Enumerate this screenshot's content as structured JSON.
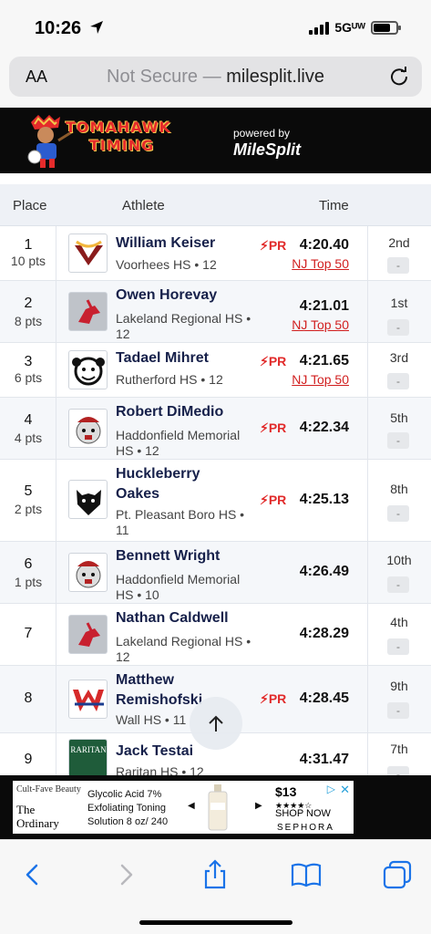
{
  "status": {
    "time": "10:26",
    "network": "5Gᵁᵂ"
  },
  "browser": {
    "aa": "AA",
    "security": "Not Secure",
    "separator": " — ",
    "domain": "milesplit.live"
  },
  "banner": {
    "brand_line1": "TOMAHAWK",
    "brand_line2": "TIMING",
    "powered_by": "powered by",
    "partner": "MileSplit"
  },
  "table": {
    "headers": {
      "place": "Place",
      "athlete": "Athlete",
      "time": "Time"
    },
    "rows": [
      {
        "place": "1",
        "pts": "10 pts",
        "name": "William Keiser",
        "school": "Voorhees HS • 12",
        "pr": "PR",
        "time": "4:20.40",
        "top50": "NJ Top 50",
        "rank": "2nd",
        "dash": "-"
      },
      {
        "place": "2",
        "pts": "8 pts",
        "name": "Owen Horevay",
        "school": "Lakeland Regional HS • 12",
        "pr": "",
        "time": "4:21.01",
        "top50": "NJ Top 50",
        "rank": "1st",
        "dash": "-"
      },
      {
        "place": "3",
        "pts": "6 pts",
        "name": "Tadael Mihret",
        "school": "Rutherford HS • 12",
        "pr": "PR",
        "time": "4:21.65",
        "top50": "NJ Top 50",
        "rank": "3rd",
        "dash": "-"
      },
      {
        "place": "4",
        "pts": "4 pts",
        "name": "Robert DiMedio",
        "school": "Haddonfield Memorial HS • 12",
        "pr": "PR",
        "time": "4:22.34",
        "top50": "",
        "rank": "5th",
        "dash": "-"
      },
      {
        "place": "5",
        "pts": "2 pts",
        "name": "Huckleberry Oakes",
        "school": "Pt. Pleasant Boro HS • 11",
        "pr": "PR",
        "time": "4:25.13",
        "top50": "",
        "rank": "8th",
        "dash": "-"
      },
      {
        "place": "6",
        "pts": "1 pts",
        "name": "Bennett Wright",
        "school": "Haddonfield Memorial HS • 10",
        "pr": "",
        "time": "4:26.49",
        "top50": "",
        "rank": "10th",
        "dash": "-"
      },
      {
        "place": "7",
        "pts": "",
        "name": "Nathan Caldwell",
        "school": "Lakeland Regional HS • 12",
        "pr": "",
        "time": "4:28.29",
        "top50": "",
        "rank": "4th",
        "dash": "-"
      },
      {
        "place": "8",
        "pts": "",
        "name": "Matthew Remishofski",
        "school": "Wall HS • 11",
        "pr": "PR",
        "time": "4:28.45",
        "top50": "",
        "rank": "9th",
        "dash": "-"
      },
      {
        "place": "9",
        "pts": "",
        "name": "Jack Testai",
        "school": "Raritan HS • 12",
        "pr": "",
        "time": "4:31.47",
        "top50": "",
        "rank": "7th",
        "dash": "-"
      }
    ]
  },
  "ad": {
    "tagline": "Cult-Fave Beauty",
    "brand": "The Ordinary",
    "product": "Glycolic Acid 7% Exfoliating Toning Solution 8 oz/ 240",
    "price": "$13",
    "stars": "★★★★☆",
    "cta": "SHOP NOW",
    "retailer": "SEPHORA",
    "close": "✕",
    "adchoices": "▷"
  },
  "colors": {
    "pr_red": "#e12a2a",
    "name_navy": "#16204a",
    "link_red": "#d11f1f",
    "ios_blue": "#1a73e8"
  }
}
